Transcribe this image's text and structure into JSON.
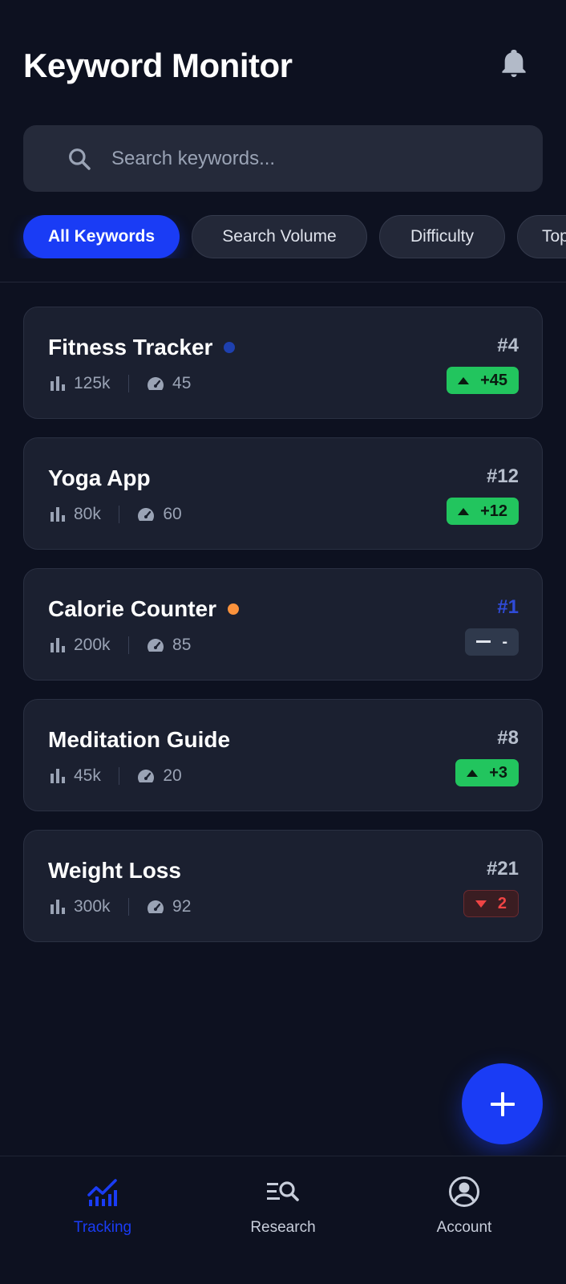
{
  "header": {
    "title": "Keyword Monitor",
    "notification_icon": "bell-icon"
  },
  "search": {
    "icon": "search-icon",
    "placeholder": "Search keywords...",
    "value": ""
  },
  "filters": [
    {
      "label": "All Keywords",
      "active": true
    },
    {
      "label": "Search Volume",
      "active": false
    },
    {
      "label": "Difficulty",
      "active": false
    },
    {
      "label": "Top",
      "active": false
    }
  ],
  "keywords": [
    {
      "name": "Fitness Tracker",
      "volume": "125k",
      "difficulty": "45",
      "rank": "#4",
      "trend": "up",
      "change": "+45",
      "dot_color": "#1e40af"
    },
    {
      "name": "Yoga App",
      "volume": "80k",
      "difficulty": "60",
      "rank": "#12",
      "trend": "up",
      "change": "+12",
      "dot_color": ""
    },
    {
      "name": "Calorie Counter",
      "volume": "200k",
      "difficulty": "85",
      "rank": "#1",
      "trend": "flat",
      "change": "-",
      "dot_color": "#fb923c"
    },
    {
      "name": "Meditation Guide",
      "volume": "45k",
      "difficulty": "20",
      "rank": "#8",
      "trend": "up",
      "change": "+3",
      "dot_color": ""
    },
    {
      "name": "Weight Loss",
      "volume": "300k",
      "difficulty": "92",
      "rank": "#21",
      "trend": "down",
      "change": "2",
      "dot_color": ""
    }
  ],
  "fab": {
    "icon": "plus-icon"
  },
  "nav": [
    {
      "label": "Tracking",
      "icon": "chart-line-icon",
      "active": true
    },
    {
      "label": "Research",
      "icon": "list-search-icon",
      "active": false
    },
    {
      "label": "Account",
      "icon": "account-circle-icon",
      "active": false
    }
  ],
  "colors": {
    "background": "#0d1120",
    "card": "#1b2030",
    "accent": "#1a3cf5",
    "rank_top": "#2f4bd8",
    "positive": "#22c55e",
    "negative": "#ef4444",
    "muted": "#9aa3b5"
  }
}
